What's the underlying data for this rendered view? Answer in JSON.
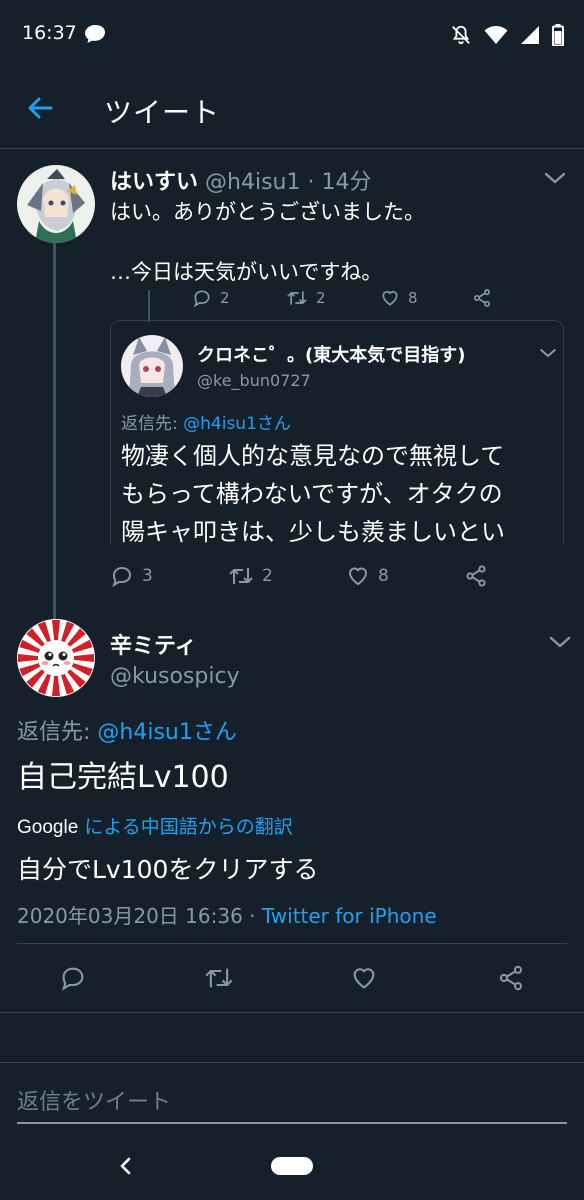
{
  "status_bar": {
    "time": "16:37"
  },
  "header": {
    "title": "ツイート"
  },
  "parent_tweet": {
    "display_name": "はいすい",
    "handle": "@h4isu1",
    "sep": "·",
    "time": "14分",
    "text_line1": "はい。ありがとうございました。",
    "text_line2": "…今日は天気がいいですね。",
    "partial_counts": {
      "replies": "2",
      "retweets": "2",
      "likes": "8"
    },
    "quote": {
      "display_name": "クロネこ゜。(東大本気で目指す)",
      "handle": "@ke_bun0727",
      "reply_label": "返信先:",
      "reply_to": "@h4isu1さん",
      "text_line1": "物凄く個人的な意見なので無視して",
      "text_line2": "もらって構わないですが、オタクの",
      "text_line3": "陽キャ叩きは、少しも羨ましいとい"
    },
    "counts": {
      "replies": "3",
      "retweets": "2",
      "likes": "8"
    }
  },
  "main_tweet": {
    "display_name": "辛ミティ",
    "handle": "@kusospicy",
    "reply_label": "返信先:",
    "reply_to": "@h4isu1さん",
    "text": "自己完結Lv100",
    "translate_brand": "Google",
    "translate_text": "による中国語からの翻訳",
    "translated": "自分でLv100をクリアする",
    "timestamp": "2020年03月20日 16:36",
    "sep": "·",
    "source": "Twitter for iPhone"
  },
  "reply_input": {
    "placeholder": "返信をツイート"
  },
  "colors": {
    "background": "#15202b",
    "accent": "#1da1f2",
    "secondary": "#8899a6",
    "border": "#38444d"
  }
}
